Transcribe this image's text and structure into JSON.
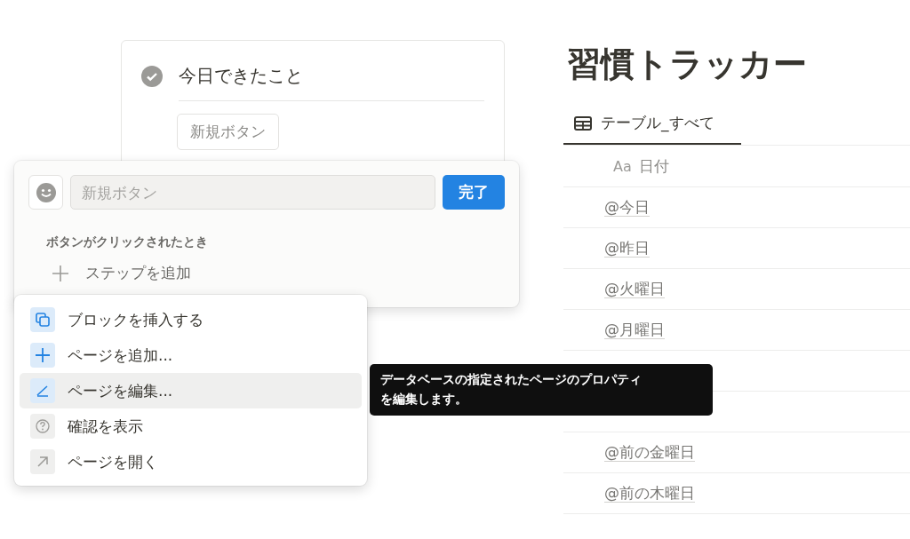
{
  "card": {
    "title": "今日できたこと",
    "checked": true,
    "button": "新規ボタン"
  },
  "editor": {
    "placeholder": "新規ボタン",
    "done": "完了",
    "section": "ボタンがクリックされたとき",
    "add_step": "ステップを追加"
  },
  "menu": [
    {
      "kind": "insert",
      "label": "ブロックを挿入する",
      "selected": false
    },
    {
      "kind": "add",
      "label": "ページを追加...",
      "selected": false
    },
    {
      "kind": "edit",
      "label": "ページを編集...",
      "selected": true
    },
    {
      "kind": "confirm",
      "label": "確認を表示",
      "selected": false
    },
    {
      "kind": "open",
      "label": "ページを開く",
      "selected": false
    }
  ],
  "tooltip": [
    "データベースの指定されたページのプロパティ",
    "を編集します。"
  ],
  "tracker": {
    "title": "習慣トラッカー",
    "tab": "テーブル_すべて",
    "column_prefix": "Aa",
    "column": "日付",
    "rows": [
      {
        "date": "@今日"
      },
      {
        "date": "@昨日"
      },
      {
        "date": "@火曜日"
      },
      {
        "date": "@月曜日"
      },
      {
        "covered": true
      },
      {
        "covered": true
      },
      {
        "date": "@前の金曜日"
      },
      {
        "date": "@前の木曜日"
      }
    ]
  }
}
